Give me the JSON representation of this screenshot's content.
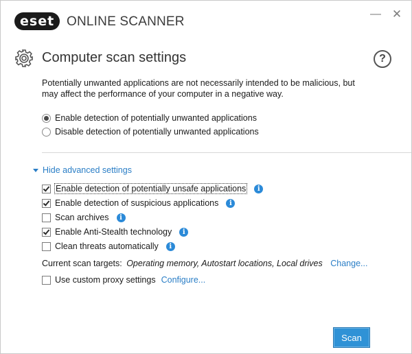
{
  "titlebar": {
    "logo": "eset",
    "product": "ONLINE SCANNER",
    "minimize_glyph": "—",
    "close_glyph": "✕"
  },
  "header": {
    "title": "Computer scan settings",
    "help_glyph": "?",
    "icon": "gear-icon"
  },
  "description": "Potentially unwanted applications are not necessarily intended to be malicious, but may affect the performance of your computer in a negative way.",
  "pua_options": [
    {
      "label": "Enable detection of potentially unwanted applications",
      "selected": true
    },
    {
      "label": "Disable detection of potentially unwanted applications",
      "selected": false
    }
  ],
  "advanced": {
    "toggle_label": "Hide advanced settings",
    "options": [
      {
        "label": "Enable detection of potentially unsafe applications",
        "checked": true,
        "info": true
      },
      {
        "label": "Enable detection of suspicious applications",
        "checked": true,
        "info": true
      },
      {
        "label": "Scan archives",
        "checked": false,
        "info": true
      },
      {
        "label": "Enable Anti-Stealth technology",
        "checked": true,
        "info": true
      },
      {
        "label": "Clean threats automatically",
        "checked": false,
        "info": true
      }
    ],
    "info_glyph": "i"
  },
  "scan_targets": {
    "label": "Current scan targets:",
    "value": "Operating memory, Autostart locations, Local drives",
    "change_link": "Change..."
  },
  "proxy": {
    "label": "Use custom proxy settings",
    "checked": false,
    "configure_link": "Configure..."
  },
  "actions": {
    "scan_label": "Scan"
  },
  "colors": {
    "accent": "#2f92d6",
    "link": "#2a7ec6",
    "info": "#2b8ad8"
  }
}
